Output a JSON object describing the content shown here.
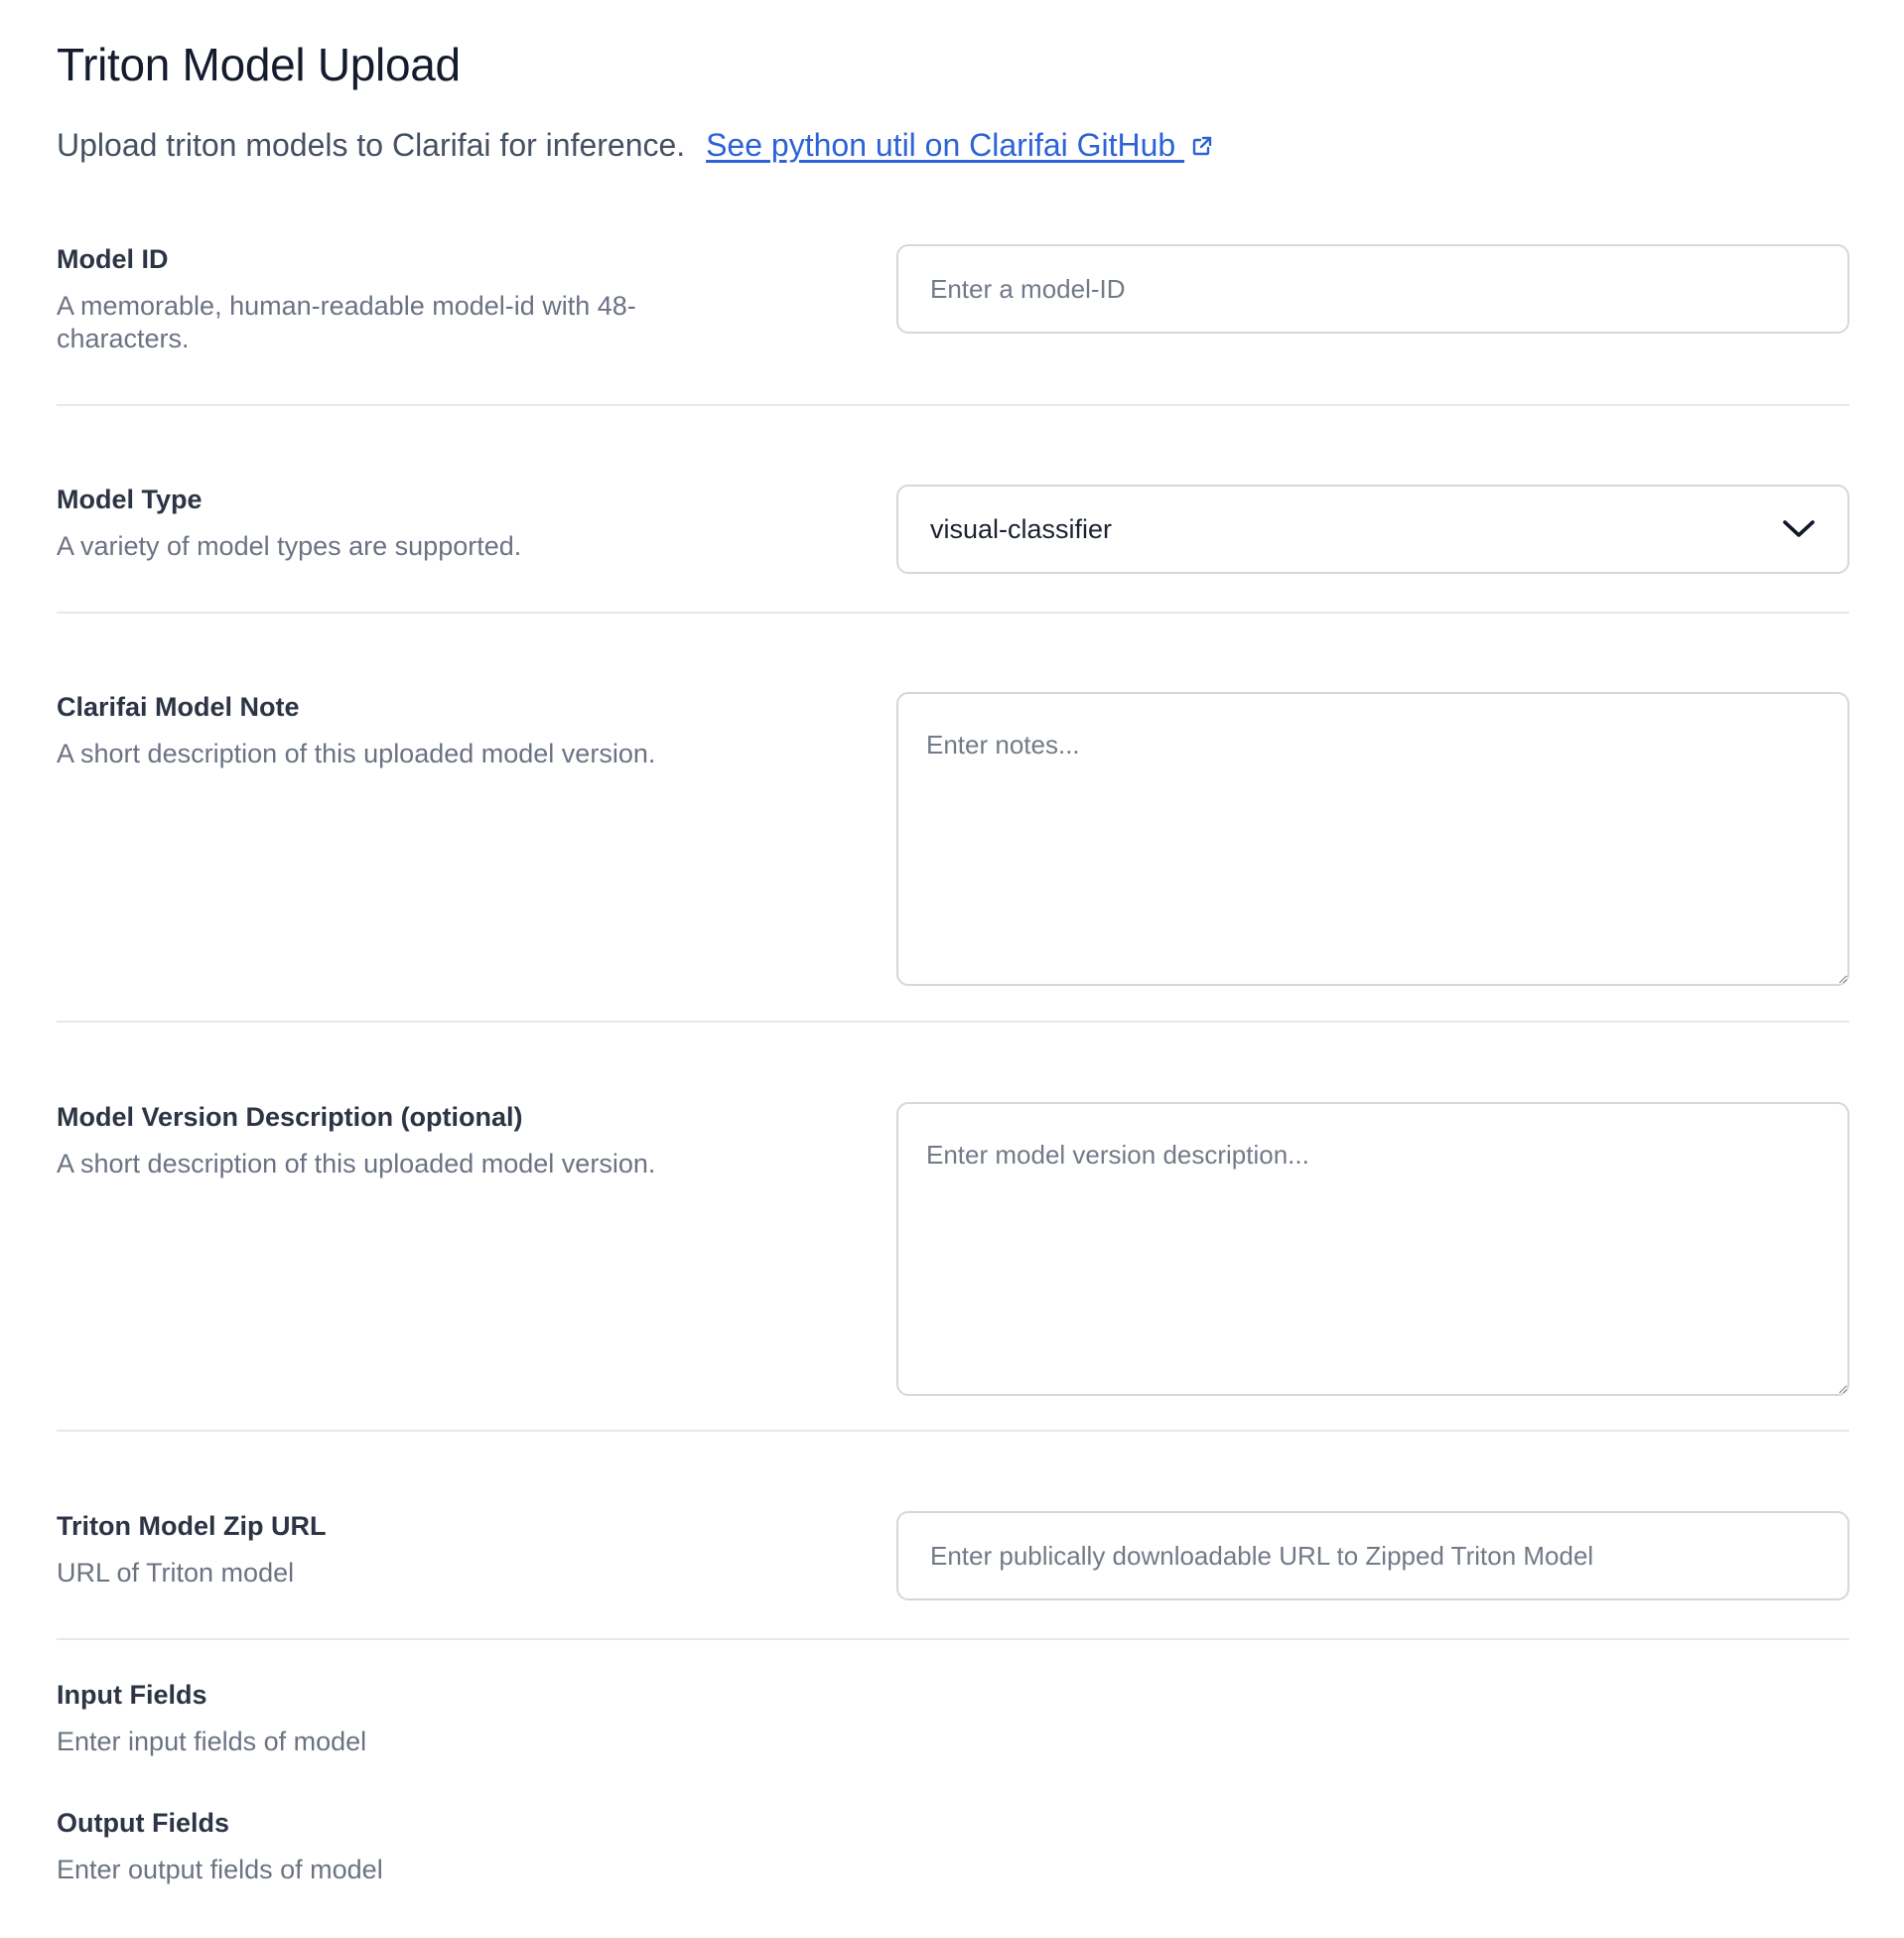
{
  "page": {
    "title": "Triton Model Upload",
    "intro_text": "Upload triton models to Clarifai for inference.",
    "github_link_label": "See python util on Clarifai GitHub "
  },
  "fields": {
    "model_id": {
      "label": "Model ID",
      "hint": "A memorable, human-readable model-id with 48-characters.",
      "placeholder": "Enter a model-ID",
      "value": ""
    },
    "model_type": {
      "label": "Model Type",
      "hint": "A variety of model types are supported.",
      "selected": "visual-classifier"
    },
    "model_note": {
      "label": "Clarifai Model Note",
      "hint": "A short description of this uploaded model version.",
      "placeholder": "Enter notes...",
      "value": ""
    },
    "version_description": {
      "label": "Model Version Description (optional)",
      "hint": "A short description of this uploaded model version.",
      "placeholder": "Enter model version description...",
      "value": ""
    },
    "zip_url": {
      "label": "Triton Model Zip URL",
      "hint": "URL of Triton model",
      "placeholder": "Enter publically downloadable URL to Zipped Triton Model",
      "value": ""
    },
    "input_fields": {
      "label": "Input Fields",
      "hint": "Enter input fields of model"
    },
    "output_fields": {
      "label": "Output Fields",
      "hint": "Enter output fields of model"
    }
  },
  "icons": {
    "external_link": "external-link-icon",
    "dropdown": "chevron-down-icon"
  },
  "colors": {
    "link": "#2d63d6",
    "border": "#d3d7de",
    "divider": "#e6e8ec"
  }
}
